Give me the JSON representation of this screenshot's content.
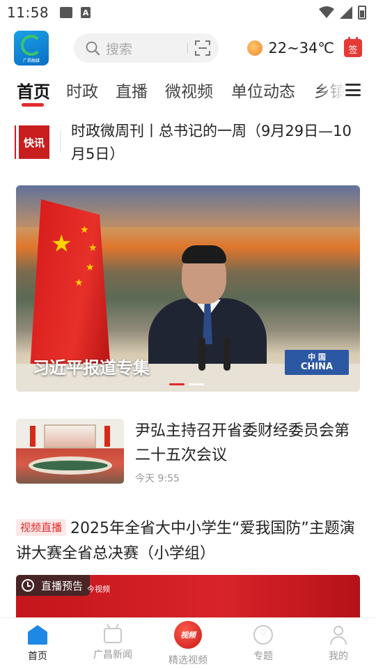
{
  "status_bar": {
    "time": "11:58"
  },
  "header": {
    "logo_text": "广昌融媒",
    "search_placeholder": "搜索",
    "temperature": "22~34℃",
    "sign_label": "签"
  },
  "tabs": [
    {
      "label": "首页",
      "active": true
    },
    {
      "label": "时政"
    },
    {
      "label": "直播"
    },
    {
      "label": "微视频"
    },
    {
      "label": "单位动态"
    },
    {
      "label": "乡镇"
    }
  ],
  "flash": {
    "badge": "快讯",
    "title": "时政微周刊丨总书记的一周（9月29日—10月5日）"
  },
  "banner": {
    "caption": "习近平报道专集",
    "plate_cn": "中 国",
    "plate_en": "CHINA",
    "slide_count": 2,
    "active_slide": 1
  },
  "news_items": [
    {
      "title": "尹弘主持召开省委财经委员会第二十五次会议",
      "time": "今天 9:55"
    }
  ],
  "live_item": {
    "tag": "视频直播",
    "title": "2025年全省大中小学生“爱我国防”主题演讲大赛全省总决赛（小学组）",
    "chip": "直播预告",
    "brand": "今视频"
  },
  "bottom_nav": [
    {
      "label": "首页",
      "icon": "home-icon",
      "active": true
    },
    {
      "label": "广昌新闻",
      "icon": "tv-icon"
    },
    {
      "label": "精选视频",
      "icon": "video-icon",
      "badge": "视频"
    },
    {
      "label": "专题",
      "icon": "topic-icon"
    },
    {
      "label": "我的",
      "icon": "mine-icon"
    }
  ],
  "colors": {
    "accent": "#e02b2b",
    "nav_active": "#1e88e5"
  }
}
